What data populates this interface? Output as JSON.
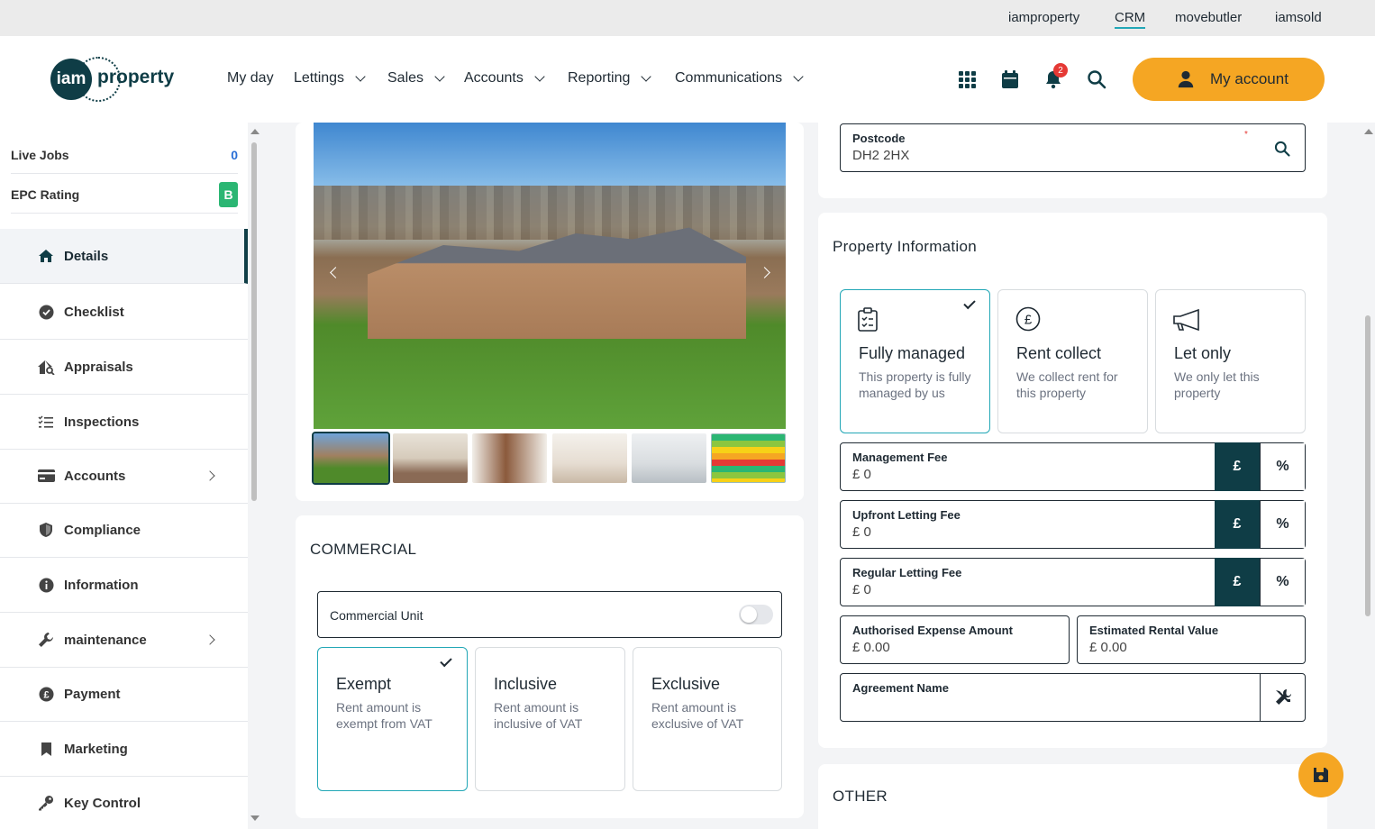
{
  "topbar": {
    "links": [
      "iamproperty",
      "CRM",
      "movebutler",
      "iamsold"
    ]
  },
  "header": {
    "logo_mark": "iam",
    "logo_word": "property",
    "nav": {
      "my_day": "My day",
      "lettings": "Lettings",
      "sales": "Sales",
      "accounts": "Accounts",
      "reporting": "Reporting",
      "communications": "Communications"
    },
    "notifications_count": "2",
    "account_label": "My account"
  },
  "sidebar": {
    "live_jobs_label": "Live Jobs",
    "live_jobs_count": "0",
    "epc_label": "EPC Rating",
    "epc_value": "B",
    "items": [
      {
        "label": "Details"
      },
      {
        "label": "Checklist"
      },
      {
        "label": "Appraisals"
      },
      {
        "label": "Inspections"
      },
      {
        "label": "Accounts"
      },
      {
        "label": "Compliance"
      },
      {
        "label": "Information"
      },
      {
        "label": "maintenance"
      },
      {
        "label": "Payment"
      },
      {
        "label": "Marketing"
      },
      {
        "label": "Key Control"
      }
    ]
  },
  "commercial": {
    "title": "COMMERCIAL",
    "unit_label": "Commercial Unit",
    "unit_enabled": false,
    "options": [
      {
        "title": "Exempt",
        "desc": "Rent amount is exempt from VAT",
        "selected": true
      },
      {
        "title": "Inclusive",
        "desc": "Rent amount is inclusive of VAT",
        "selected": false
      },
      {
        "title": "Exclusive",
        "desc": "Rent amount is exclusive of VAT",
        "selected": false
      }
    ]
  },
  "address": {
    "postcode_label": "Postcode",
    "postcode_value": "DH2 2HX"
  },
  "property_info": {
    "title": "Property Information",
    "management_types": [
      {
        "title": "Fully managed",
        "desc": "This property is fully managed by us",
        "selected": true
      },
      {
        "title": "Rent collect",
        "desc": "We collect rent for this property",
        "selected": false
      },
      {
        "title": "Let only",
        "desc": "We only let this property",
        "selected": false
      }
    ],
    "management_fee": {
      "label": "Management Fee",
      "value": "£ 0"
    },
    "upfront_letting_fee": {
      "label": "Upfront Letting Fee",
      "value": "£ 0"
    },
    "regular_letting_fee": {
      "label": "Regular Letting Fee",
      "value": "£ 0"
    },
    "currency_symbol": "£",
    "percent_symbol": "%",
    "authorised_expense": {
      "label": "Authorised Expense Amount",
      "value": "£ 0.00"
    },
    "estimated_rental": {
      "label": "Estimated Rental Value",
      "value": "£ 0.00"
    },
    "agreement_name_label": "Agreement Name",
    "agreement_name_value": ""
  },
  "other": {
    "title": "OTHER"
  },
  "colors": {
    "brand_dark": "#0f3d46",
    "accent_orange": "#f5a623",
    "accent_teal": "#22a7b6",
    "epc_green": "#2bb673"
  }
}
